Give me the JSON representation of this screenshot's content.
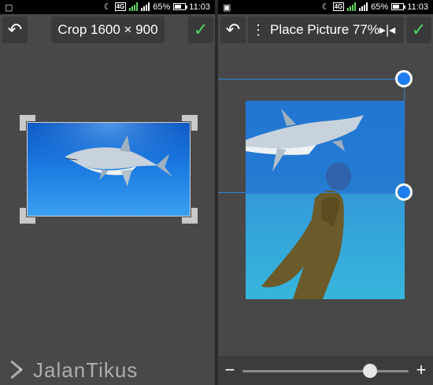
{
  "status_bar": {
    "time": "11:03",
    "battery": "65%",
    "network": "4G",
    "sim1": "1",
    "sim2": "2"
  },
  "left_panel": {
    "toolbar": {
      "title": "Crop 1600 × 900",
      "undo_icon": "undo-icon",
      "confirm_icon": "check-icon"
    }
  },
  "right_panel": {
    "toolbar": {
      "title": "Place Picture 77%",
      "undo_icon": "undo-icon",
      "menu_icon": "vertical-dots-icon",
      "flip_icon": "flip-horizontal-icon",
      "confirm_icon": "check-icon"
    },
    "bottom_bar": {
      "minus_label": "−",
      "plus_label": "+",
      "zoom_level": 0.77
    }
  },
  "watermark": {
    "text": "JalanTikus"
  },
  "colors": {
    "accent": "#1e7df0",
    "confirm": "#4cd964",
    "background": "#484848"
  }
}
